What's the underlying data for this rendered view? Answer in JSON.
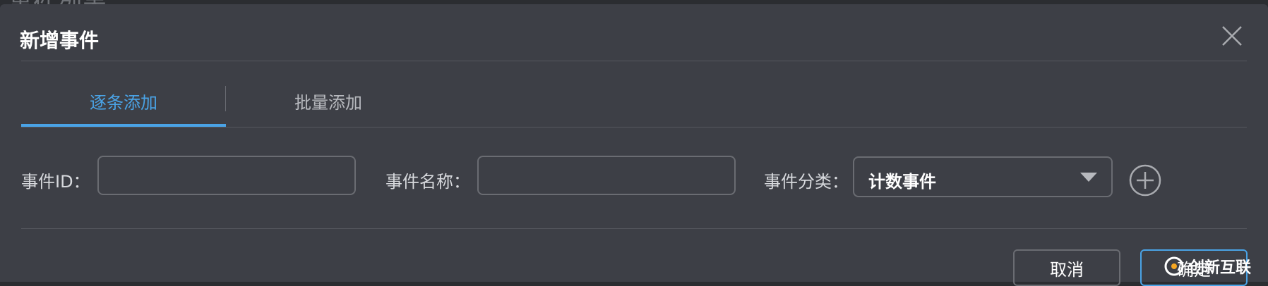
{
  "background": {
    "title": "事件列表"
  },
  "dialog": {
    "title": "新增事件",
    "close_icon": "close-icon",
    "tabs": [
      {
        "label": "逐条添加",
        "active": true
      },
      {
        "label": "批量添加",
        "active": false
      }
    ],
    "form": {
      "event_id_label": "事件ID：",
      "event_id_value": "",
      "event_name_label": "事件名称：",
      "event_name_value": "",
      "event_category_label": "事件分类：",
      "event_category_value": "计数事件",
      "add_icon": "plus-circle-icon"
    },
    "buttons": {
      "cancel": "取消",
      "confirm": "确定"
    }
  },
  "watermark": {
    "text": "创新互联"
  },
  "colors": {
    "accent": "#4aa3e6",
    "dialog_bg": "#3d3f46",
    "border": "#6a6c72"
  }
}
